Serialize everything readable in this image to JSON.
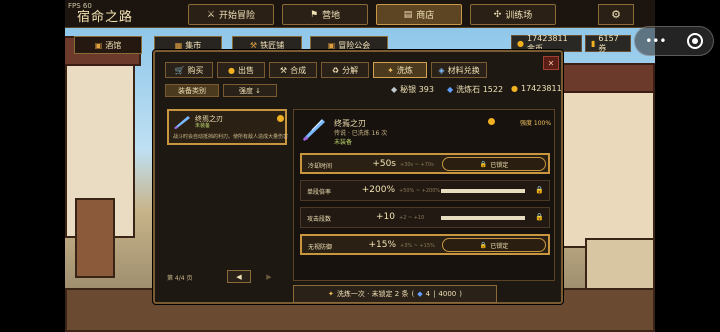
{
  "fps": "FPS 60",
  "title": "宿命之路",
  "nav": [
    {
      "label": "开始冒险",
      "icon": "swords-icon"
    },
    {
      "label": "营地",
      "icon": "flag-icon"
    },
    {
      "label": "商店",
      "icon": "shop-icon"
    },
    {
      "label": "训练场",
      "icon": "target-icon"
    }
  ],
  "settings_icon": "⚙",
  "subnav": [
    {
      "label": "酒馆",
      "icon": "mug-icon"
    },
    {
      "label": "集市",
      "icon": "stall-icon"
    },
    {
      "label": "铁匠铺",
      "icon": "anvil-icon"
    },
    {
      "label": "冒险公会",
      "icon": "guild-icon"
    }
  ],
  "currency": {
    "gold": "17423811 金币",
    "tickets": "6157 券"
  },
  "dialog": {
    "tabs": [
      {
        "label": "购买",
        "icon": "cart-icon"
      },
      {
        "label": "出售",
        "icon": "coins-icon"
      },
      {
        "label": "合成",
        "icon": "hammer-icon"
      },
      {
        "label": "分解",
        "icon": "recycle-icon"
      },
      {
        "label": "洗炼",
        "icon": "sparkle-icon"
      },
      {
        "label": "材料兑换",
        "icon": "exchange-icon"
      }
    ],
    "close": "✕",
    "stats": {
      "silver": "秘银 393",
      "washstone": "洗炼石 1522",
      "gold": "17423811"
    },
    "filters": {
      "category": "装备类别",
      "strength": "强度 ↓"
    },
    "item": {
      "name": "终焉之刃",
      "equip": "未装备",
      "desc": "战斗时会自动抵挡的利刃。使所有敌人造成大量伤害"
    },
    "page": "第 4/4 页",
    "prev": "◀",
    "next": "▶"
  },
  "detail": {
    "name": "终焉之刃",
    "sub": "传说 · 已洗炼 16 次",
    "equip": "未装备",
    "quality": "强度 100%",
    "attributes": [
      {
        "name": "冷却时间",
        "value": "+50s",
        "range": "+30s ~ +70s",
        "locked": true,
        "lock_label": "已锁定"
      },
      {
        "name": "单段倍率",
        "value": "+200%",
        "range": "+50% ~ +200%",
        "locked": false,
        "fill": 1.0
      },
      {
        "name": "攻击段数",
        "value": "+10",
        "range": "+2 ~ +10",
        "locked": false,
        "fill": 1.0
      },
      {
        "name": "无视防御",
        "value": "+15%",
        "range": "+3% ~ +15%",
        "locked": true,
        "lock_label": "已锁定"
      }
    ]
  },
  "refine": {
    "label": "洗炼一次 · 未锁定 2 条",
    "count": "4",
    "cost": "4000"
  }
}
